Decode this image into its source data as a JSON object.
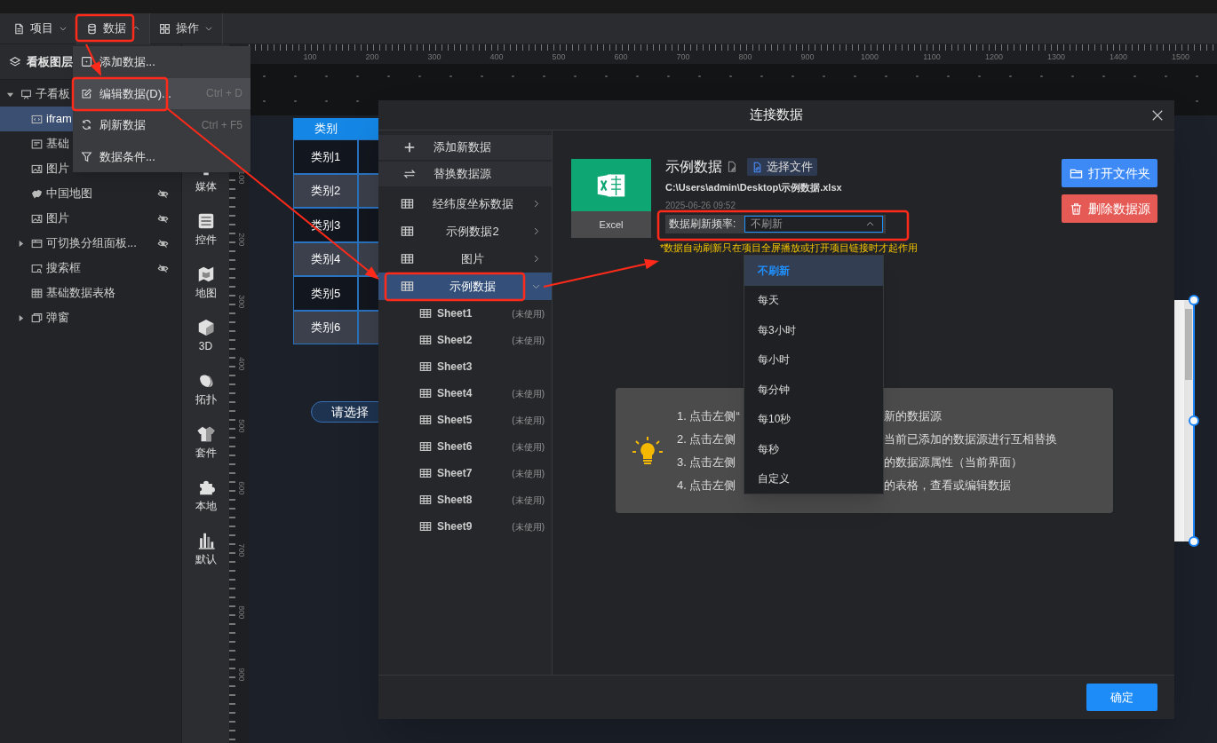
{
  "toolbar": {
    "menus": [
      {
        "label": "项目",
        "kind": "file",
        "open": false
      },
      {
        "label": "数据",
        "kind": "database",
        "open": true
      },
      {
        "label": "操作",
        "kind": "grid",
        "open": false
      }
    ]
  },
  "data_menu": {
    "items": [
      {
        "label": "添加数据...",
        "kind": "add",
        "selected": false
      },
      {
        "label": "编辑数据(D)...",
        "kind": "edit",
        "shortcut": "Ctrl + D",
        "selected": true
      },
      {
        "label": "刷新数据",
        "kind": "refresh",
        "shortcut": "Ctrl + F5",
        "selected": false
      },
      {
        "label": "数据条件...",
        "kind": "filter",
        "selected": false
      }
    ]
  },
  "layers": {
    "title": "看板图层",
    "items": [
      {
        "label": "子看板",
        "kind": "board",
        "expanded": true,
        "selected": false,
        "hidden": false,
        "children": [
          {
            "label": "ifram",
            "kind": "iframe",
            "selected": true,
            "hidden": false
          },
          {
            "label": "基础",
            "kind": "form",
            "selected": false,
            "hidden": false
          },
          {
            "label": "图片",
            "kind": "image",
            "selected": false,
            "hidden": false
          },
          {
            "label": "中国地图",
            "kind": "map",
            "selected": false,
            "hidden": true
          },
          {
            "label": "图片",
            "kind": "image",
            "selected": false,
            "hidden": true
          },
          {
            "label": "可切换分组面板...",
            "kind": "tabs",
            "expanded": false,
            "selected": false,
            "hidden": true
          },
          {
            "label": "搜索框",
            "kind": "search",
            "selected": false,
            "hidden": true
          },
          {
            "label": "基础数据表格",
            "kind": "table",
            "selected": false,
            "hidden": false
          },
          {
            "label": "弹窗",
            "kind": "popup",
            "expanded": false,
            "selected": false,
            "hidden": false
          }
        ]
      }
    ]
  },
  "components": [
    {
      "label": "媒体",
      "kind": "media"
    },
    {
      "label": "控件",
      "kind": "controls"
    },
    {
      "label": "地图",
      "kind": "map"
    },
    {
      "label": "3D",
      "kind": "cube"
    },
    {
      "label": "拓扑",
      "kind": "topology"
    },
    {
      "label": "套件",
      "kind": "suite"
    },
    {
      "label": "本地",
      "kind": "local"
    },
    {
      "label": "默认",
      "kind": "chart"
    }
  ],
  "ruler": {
    "x_labels": [
      "100",
      "200",
      "300",
      "400",
      "500",
      "600",
      "700",
      "800",
      "900",
      "1000",
      "1100",
      "1200",
      "1300",
      "1400",
      "1500"
    ],
    "y_labels": [
      "100",
      "200",
      "300",
      "400",
      "500",
      "600",
      "700",
      "800",
      "900"
    ]
  },
  "canvas": {
    "table": {
      "header": "类别",
      "rows": [
        "类别1",
        "类别2",
        "类别3",
        "类别4",
        "类别5",
        "类别6"
      ]
    },
    "select": {
      "text": "请选择"
    }
  },
  "dialog": {
    "title": "连接数据",
    "actions": [
      {
        "label": "添加新数据",
        "kind": "add"
      },
      {
        "label": "替换数据源",
        "kind": "swap"
      }
    ],
    "sources": [
      {
        "label": "经纬度坐标数据",
        "expanded": false,
        "selected": false
      },
      {
        "label": "示例数据2",
        "expanded": false,
        "selected": false
      },
      {
        "label": "图片",
        "expanded": false,
        "selected": false
      },
      {
        "label": "示例数据",
        "expanded": true,
        "selected": true,
        "sheets": [
          {
            "label": "Sheet1",
            "note": "(未使用)"
          },
          {
            "label": "Sheet2",
            "note": "(未使用)"
          },
          {
            "label": "Sheet3"
          },
          {
            "label": "Sheet4",
            "note": "(未使用)"
          },
          {
            "label": "Sheet5",
            "note": "(未使用)"
          },
          {
            "label": "Sheet6",
            "note": "(未使用)"
          },
          {
            "label": "Sheet7",
            "note": "(未使用)"
          },
          {
            "label": "Sheet8",
            "note": "(未使用)"
          },
          {
            "label": "Sheet9",
            "note": "(未使用)"
          }
        ]
      }
    ],
    "file": {
      "type_label": "Excel",
      "name": "示例数据",
      "choose_label": "选择文件",
      "path": "C:\\Users\\admin\\Desktop\\示例数据.xlsx",
      "date": "2025-06-26 09:52",
      "refresh_label": "数据刷新频率:",
      "refresh_value": "不刷新",
      "refresh_open": true,
      "notice": "*数据自动刷新只在项目全屏播放或打开项目链接时才起作用"
    },
    "buttons": [
      {
        "label": "打开文件夹",
        "kind": "open"
      },
      {
        "label": "删除数据源",
        "kind": "delete"
      }
    ],
    "refresh_options": [
      {
        "label": "不刷新",
        "selected": true
      },
      {
        "label": "每天",
        "selected": false
      },
      {
        "label": "每3小时",
        "selected": false
      },
      {
        "label": "每小时",
        "selected": false
      },
      {
        "label": "每分钟",
        "selected": false
      },
      {
        "label": "每10秒",
        "selected": false
      },
      {
        "label": "每秒",
        "selected": false
      },
      {
        "label": "自定义",
        "selected": false
      }
    ],
    "tips": [
      {
        "before": "1. 点击左侧“",
        "after": "新的数据源"
      },
      {
        "before": "2. 点击左侧",
        "after": "当前已添加的数据源进行互相替换"
      },
      {
        "before": "3. 点击左侧",
        "after": "的数据源属性（当前界面）"
      },
      {
        "before": "4. 点击左侧",
        "after": "的表格，查看或编辑数据"
      }
    ],
    "confirm": "确定"
  }
}
